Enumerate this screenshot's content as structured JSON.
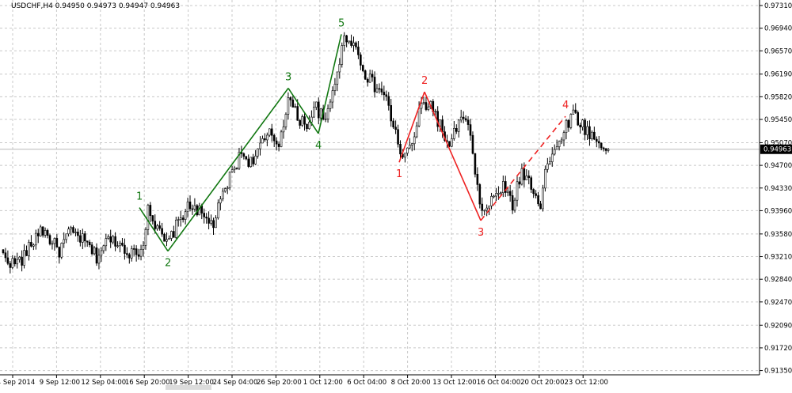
{
  "chart_data": {
    "type": "candlestick",
    "title": "USDCHF,H4  0.94950 0.94973 0.94947 0.94963",
    "symbol": "USDCHF,H4",
    "ohlc_header": [
      "0.94950",
      "0.94973",
      "0.94947",
      "0.94963"
    ],
    "current_price": "0.94963",
    "ylim": [
      0.9128,
      0.974
    ],
    "y_ticks": [
      "0.97310",
      "0.96940",
      "0.96570",
      "0.96190",
      "0.95820",
      "0.95450",
      "0.95070",
      "0.94700",
      "0.94330",
      "0.93960",
      "0.93580",
      "0.93210",
      "0.92840",
      "0.92470",
      "0.92090",
      "0.91720",
      "0.91350"
    ],
    "x_ticks": [
      "4 Sep 2014",
      "9 Sep 12:00",
      "12 Sep 04:00",
      "16 Sep 20:00",
      "19 Sep 12:00",
      "24 Sep 04:00",
      "26 Sep 20:00",
      "1 Oct 12:00",
      "6 Oct 04:00",
      "8 Oct 20:00",
      "13 Oct 12:00",
      "16 Oct 04:00",
      "20 Oct 20:00",
      "23 Oct 12:00"
    ],
    "grid": true,
    "colors": {
      "bull_wave": "#117711",
      "bear_wave": "#ee2222",
      "candle": "#000000",
      "grid": "#c8c8c8",
      "price_line": "#b8b8b8"
    },
    "price_path": [
      {
        "bar": 0,
        "close": 0.9322
      },
      {
        "bar": 4,
        "close": 0.931
      },
      {
        "bar": 8,
        "close": 0.9316
      },
      {
        "bar": 12,
        "close": 0.934
      },
      {
        "bar": 16,
        "close": 0.9368
      },
      {
        "bar": 20,
        "close": 0.935
      },
      {
        "bar": 24,
        "close": 0.933
      },
      {
        "bar": 28,
        "close": 0.936
      },
      {
        "bar": 32,
        "close": 0.9355
      },
      {
        "bar": 36,
        "close": 0.934
      },
      {
        "bar": 40,
        "close": 0.932
      },
      {
        "bar": 44,
        "close": 0.9346
      },
      {
        "bar": 48,
        "close": 0.9348
      },
      {
        "bar": 52,
        "close": 0.9335
      },
      {
        "bar": 56,
        "close": 0.9324
      },
      {
        "bar": 60,
        "close": 0.9338
      },
      {
        "bar": 62,
        "close": 0.941
      },
      {
        "bar": 65,
        "close": 0.937
      },
      {
        "bar": 70,
        "close": 0.934
      },
      {
        "bar": 74,
        "close": 0.937
      },
      {
        "bar": 78,
        "close": 0.9398
      },
      {
        "bar": 82,
        "close": 0.9405
      },
      {
        "bar": 86,
        "close": 0.9382
      },
      {
        "bar": 90,
        "close": 0.9375
      },
      {
        "bar": 94,
        "close": 0.942
      },
      {
        "bar": 98,
        "close": 0.946
      },
      {
        "bar": 102,
        "close": 0.949
      },
      {
        "bar": 106,
        "close": 0.9475
      },
      {
        "bar": 110,
        "close": 0.95
      },
      {
        "bar": 114,
        "close": 0.952
      },
      {
        "bar": 118,
        "close": 0.9505
      },
      {
        "bar": 122,
        "close": 0.958
      },
      {
        "bar": 126,
        "close": 0.9548
      },
      {
        "bar": 130,
        "close": 0.9538
      },
      {
        "bar": 134,
        "close": 0.9565
      },
      {
        "bar": 138,
        "close": 0.9538
      },
      {
        "bar": 142,
        "close": 0.961
      },
      {
        "bar": 146,
        "close": 0.9675
      },
      {
        "bar": 148,
        "close": 0.9682
      },
      {
        "bar": 151,
        "close": 0.966
      },
      {
        "bar": 155,
        "close": 0.962
      },
      {
        "bar": 159,
        "close": 0.9598
      },
      {
        "bar": 163,
        "close": 0.9588
      },
      {
        "bar": 167,
        "close": 0.9535
      },
      {
        "bar": 171,
        "close": 0.948
      },
      {
        "bar": 175,
        "close": 0.9505
      },
      {
        "bar": 179,
        "close": 0.9568
      },
      {
        "bar": 183,
        "close": 0.957
      },
      {
        "bar": 187,
        "close": 0.9535
      },
      {
        "bar": 191,
        "close": 0.9495
      },
      {
        "bar": 195,
        "close": 0.9545
      },
      {
        "bar": 199,
        "close": 0.9538
      },
      {
        "bar": 203,
        "close": 0.9428
      },
      {
        "bar": 206,
        "close": 0.939
      },
      {
        "bar": 210,
        "close": 0.942
      },
      {
        "bar": 214,
        "close": 0.9435
      },
      {
        "bar": 218,
        "close": 0.9405
      },
      {
        "bar": 222,
        "close": 0.946
      },
      {
        "bar": 226,
        "close": 0.944
      },
      {
        "bar": 230,
        "close": 0.9405
      },
      {
        "bar": 232,
        "close": 0.9465
      },
      {
        "bar": 236,
        "close": 0.949
      },
      {
        "bar": 240,
        "close": 0.953
      },
      {
        "bar": 244,
        "close": 0.9555
      },
      {
        "bar": 248,
        "close": 0.9535
      },
      {
        "bar": 252,
        "close": 0.9518
      },
      {
        "bar": 256,
        "close": 0.95
      },
      {
        "bar": 259,
        "close": 0.9496
      }
    ],
    "wave_points": {
      "green": [
        {
          "label": "1",
          "price": 0.9401
        },
        {
          "label": "2",
          "price": 0.933
        },
        {
          "label": "3",
          "price": 0.9596
        },
        {
          "label": "4",
          "price": 0.9522
        },
        {
          "label": "5",
          "price": 0.9684
        }
      ],
      "red": [
        {
          "label": "1",
          "price": 0.9475
        },
        {
          "label": "2",
          "price": 0.959
        },
        {
          "label": "3",
          "price": 0.938
        },
        {
          "label": "4",
          "price": 0.955
        }
      ]
    }
  }
}
